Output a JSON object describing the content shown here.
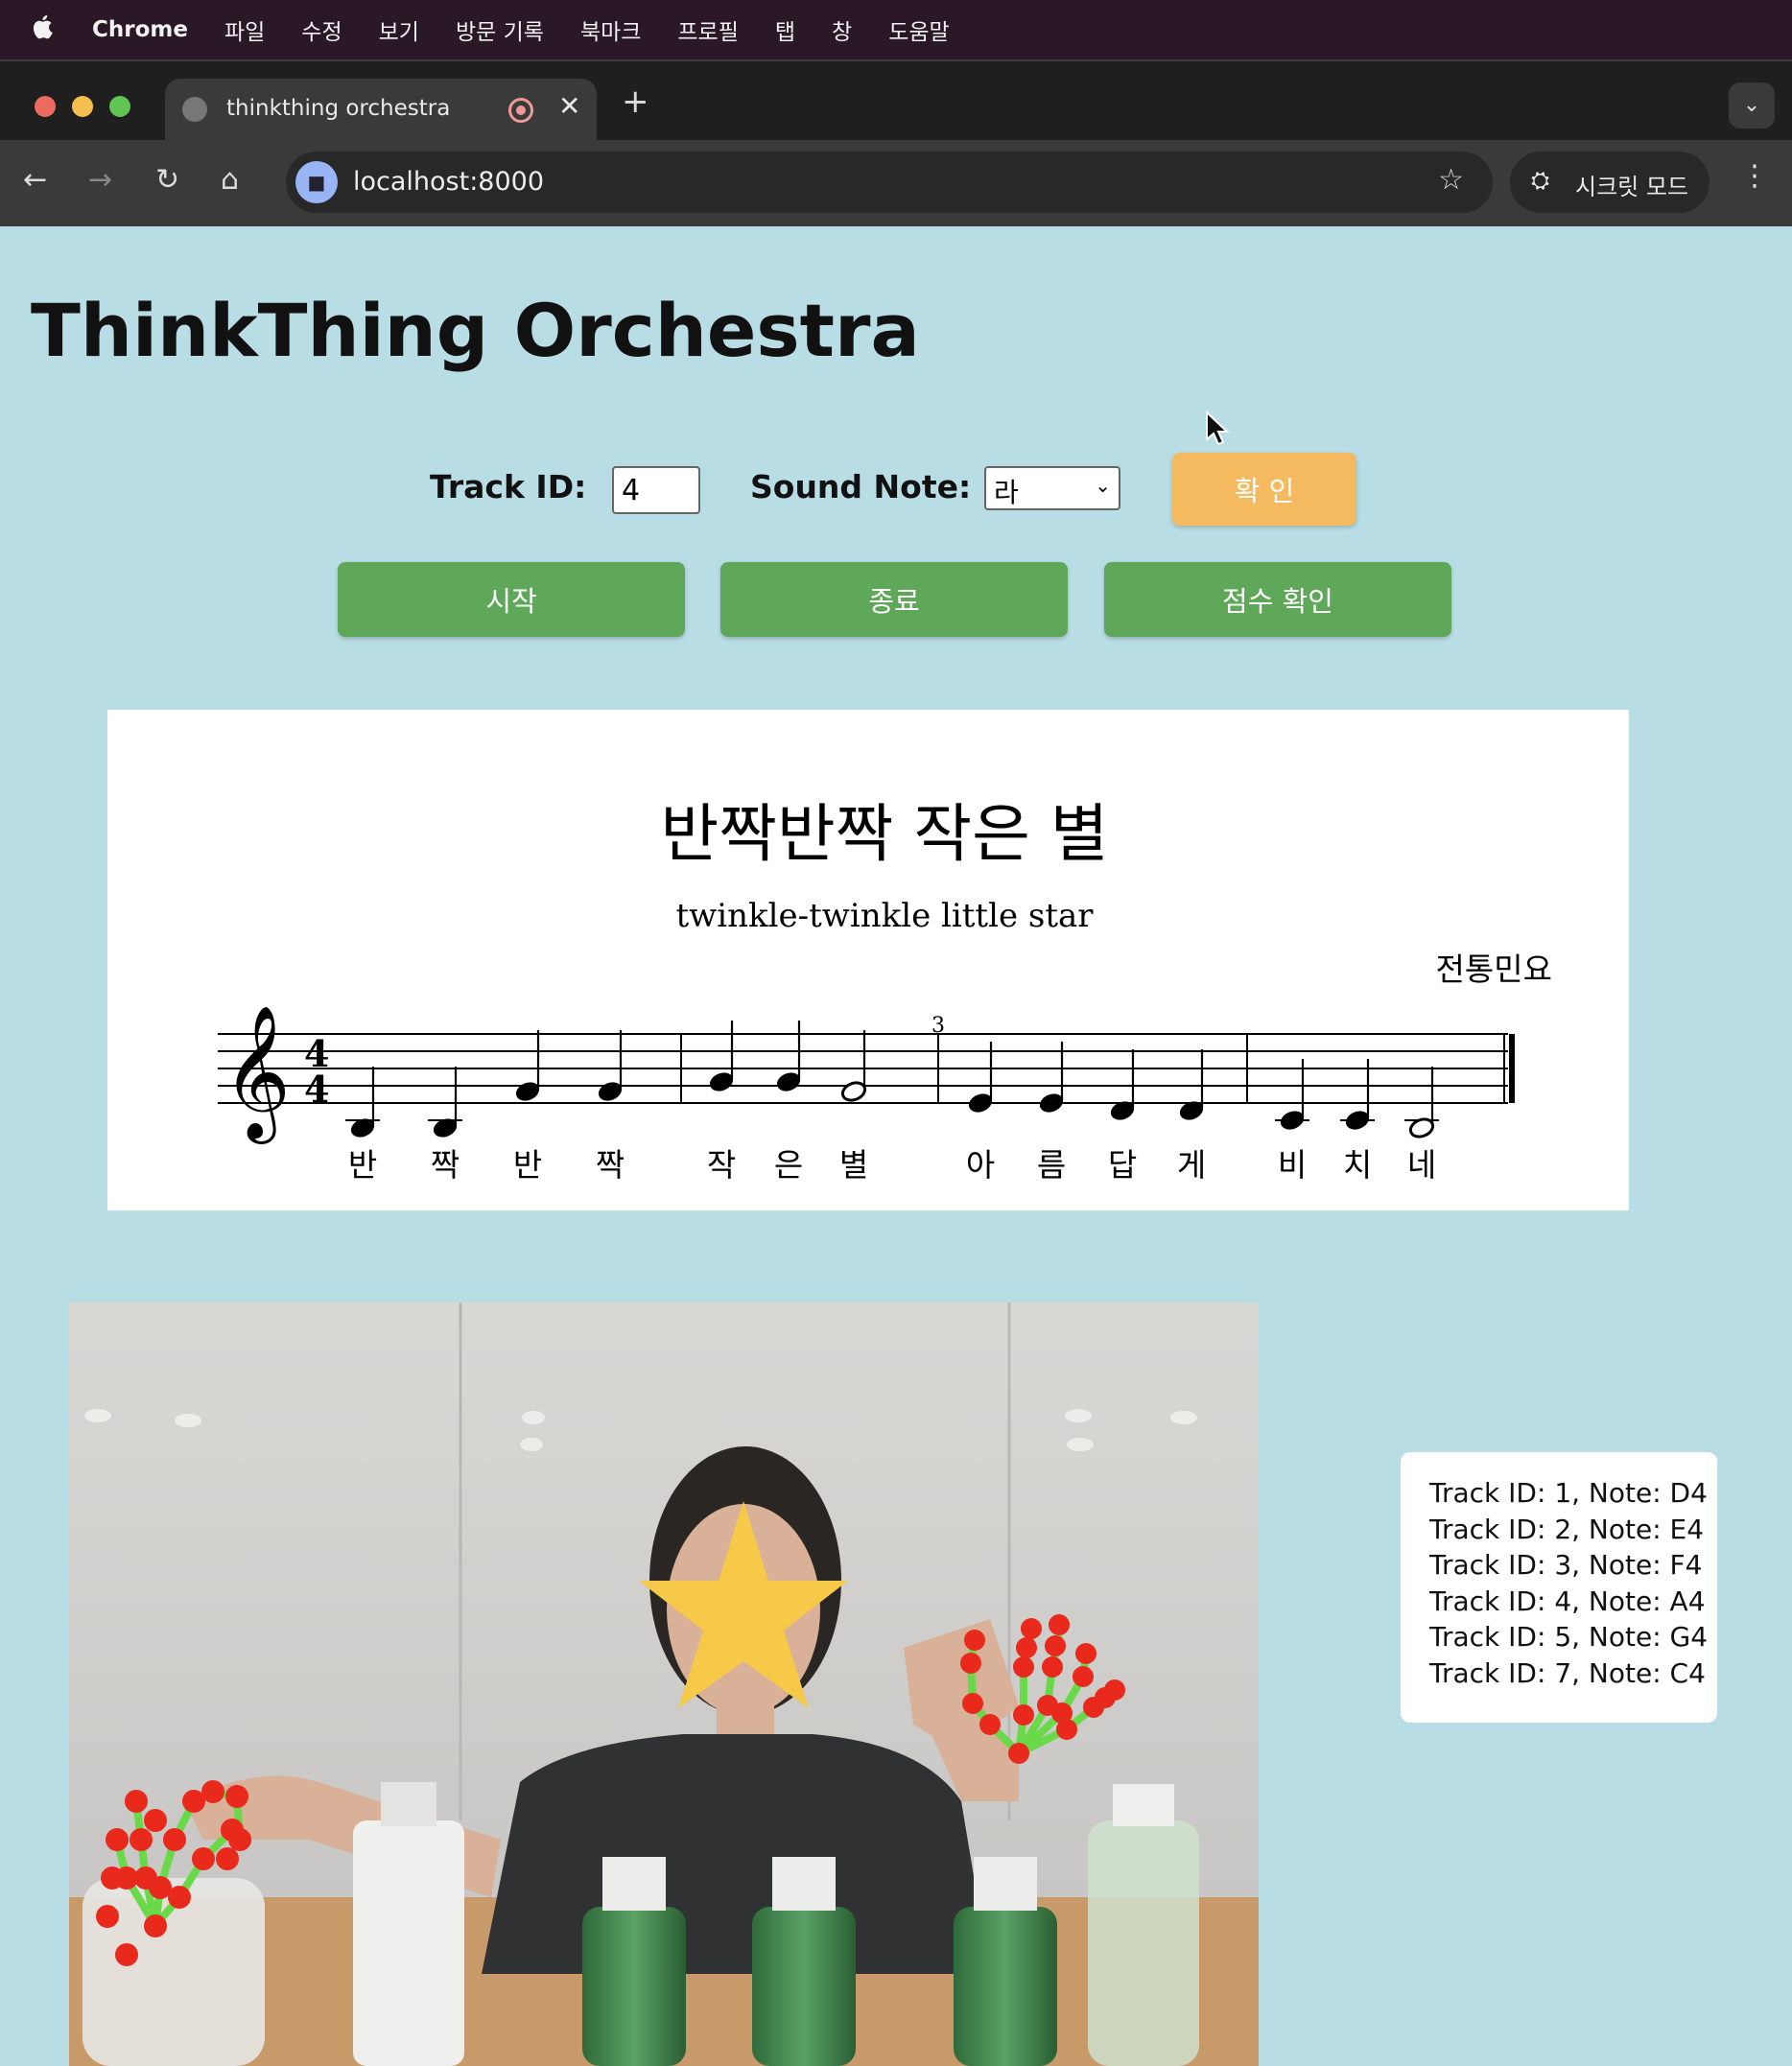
{
  "menubar": {
    "app_name": "Chrome",
    "items": [
      "파일",
      "수정",
      "보기",
      "방문 기록",
      "북마크",
      "프로필",
      "탭",
      "창",
      "도움말"
    ]
  },
  "browser": {
    "tab_title": "thinkthing orchestra",
    "url": "localhost:8000",
    "incognito_label": "시크릿 모드"
  },
  "page": {
    "title": "ThinkThing Orchestra",
    "track_id_label": "Track ID:",
    "track_id_value": "4",
    "sound_note_label": "Sound Note:",
    "sound_note_value": "라",
    "confirm_button": "확 인",
    "start_button": "시작",
    "stop_button": "종료",
    "score_button": "점수 확인"
  },
  "sheet_music": {
    "title": "반짝반짝 작은 별",
    "subtitle": "twinkle-twinkle little star",
    "composer": "전통민요",
    "time_signature": "4/4",
    "measure_number": "3",
    "lyrics": [
      "반",
      "짝",
      "반",
      "짝",
      "작",
      "은",
      "별",
      "아",
      "름",
      "답",
      "게",
      "비",
      "치",
      "네"
    ]
  },
  "tracks": [
    "Track ID: 1, Note: D4",
    "Track ID: 2, Note: E4",
    "Track ID: 3, Note: F4",
    "Track ID: 4, Note: A4",
    "Track ID: 5, Note: G4",
    "Track ID: 7, Note: C4"
  ],
  "colors": {
    "page_bg": "#b9dde4",
    "confirm_button": "#f5b95f",
    "action_button": "#5fa85a",
    "landmark_point": "#e8291c",
    "landmark_line": "#69d94a",
    "face_star": "#f7c948"
  },
  "icons": [
    "apple-icon",
    "globe-icon",
    "recording-icon",
    "close-icon",
    "plus-icon",
    "chevron-down-icon",
    "back-icon",
    "forward-icon",
    "reload-icon",
    "home-icon",
    "camera-icon",
    "star-icon",
    "incognito-icon",
    "more-icon"
  ]
}
